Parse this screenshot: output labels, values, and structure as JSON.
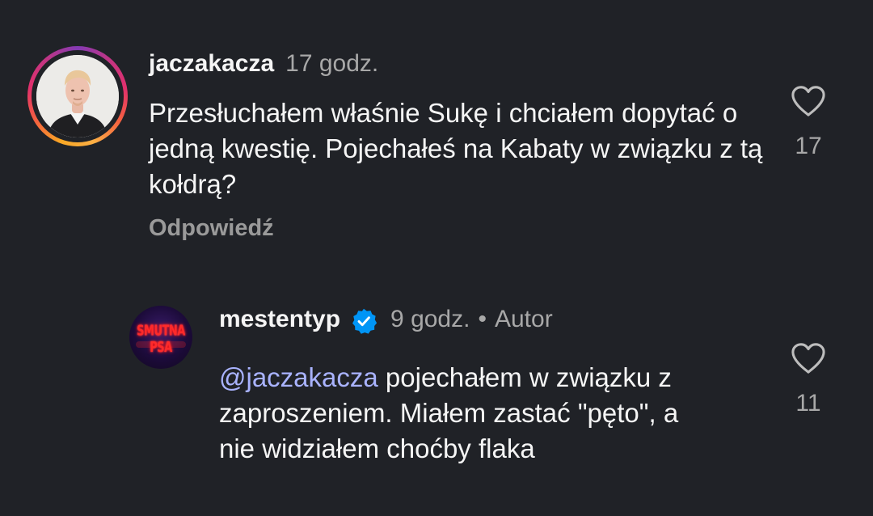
{
  "comments": [
    {
      "username": "jaczakacza",
      "time": "17 godz.",
      "text": "Przesłuchałem właśnie Sukę i chciałem dopytać o jedną kwestię. Pojechałeś na Kabaty w związku z tą kołdrą?",
      "reply_label": "Odpowiedź",
      "likes": "17",
      "avatar_icon": "profile-photo"
    },
    {
      "username": "mestentyp",
      "verified": true,
      "time": "9 godz.",
      "separator": "•",
      "author_label": "Autor",
      "mention": "@jaczakacza",
      "text": " pojechałem w związku z zaproszeniem. Miałem zastać \"pęto\", a nie widziałem choćby flaka",
      "likes": "11",
      "avatar_text": "SMUTNA PSA",
      "avatar_icon": "profile-logo"
    }
  ],
  "colors": {
    "background": "#202227",
    "mention": "#a9b3ff",
    "verified": "#0095f6",
    "secondary_text": "#a8a8a8"
  },
  "icons": [
    "heart-icon",
    "verified-badge-icon"
  ]
}
